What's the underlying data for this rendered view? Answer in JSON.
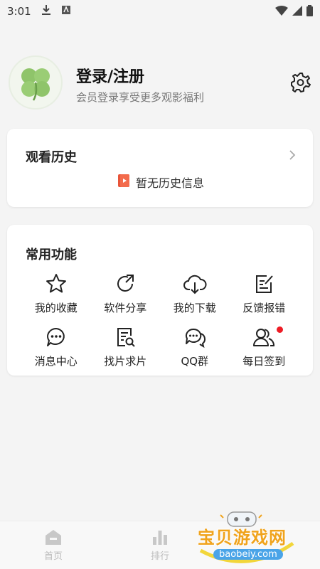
{
  "status_bar": {
    "time": "3:01"
  },
  "profile": {
    "title": "登录/注册",
    "subtitle": "会员登录享受更多观影福利"
  },
  "history": {
    "title": "观看历史",
    "empty_text": "暂无历史信息"
  },
  "functions": {
    "title": "常用功能",
    "items": [
      {
        "label": "我的收藏",
        "icon": "star-icon"
      },
      {
        "label": "软件分享",
        "icon": "share-icon"
      },
      {
        "label": "我的下载",
        "icon": "cloud-download-icon"
      },
      {
        "label": "反馈报错",
        "icon": "feedback-icon"
      },
      {
        "label": "消息中心",
        "icon": "message-icon"
      },
      {
        "label": "找片求片",
        "icon": "search-doc-icon"
      },
      {
        "label": "QQ群",
        "icon": "chat-bubbles-icon"
      },
      {
        "label": "每日签到",
        "icon": "users-icon",
        "badge": true
      }
    ]
  },
  "bottom_nav": [
    {
      "label": "首页",
      "icon": "home-icon"
    },
    {
      "label": "排行",
      "icon": "ranking-icon"
    }
  ],
  "watermark": {
    "text": "宝贝游戏网",
    "url": "baobeiy.com"
  },
  "colors": {
    "accent_red": "#ee1c25",
    "card_bg": "#ffffff",
    "page_bg": "#f4f4f4"
  }
}
